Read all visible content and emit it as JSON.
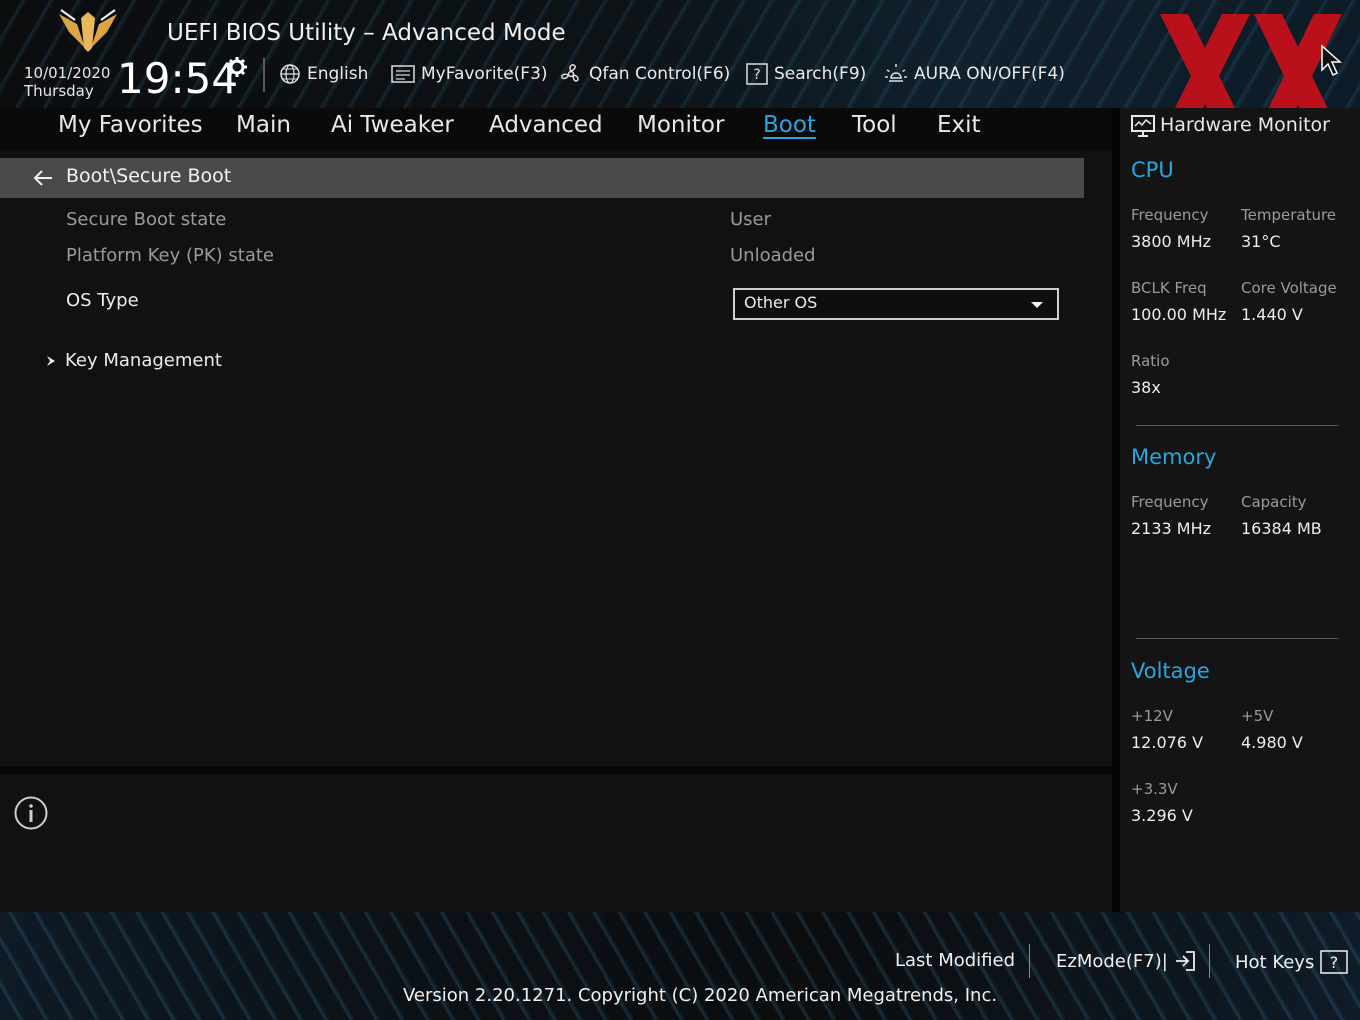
{
  "header": {
    "title": "UEFI BIOS Utility – Advanced Mode",
    "date": "10/01/2020",
    "day": "Thursday",
    "time": "19:54",
    "tools": [
      {
        "label": "English",
        "icon": "globe-icon"
      },
      {
        "label": "MyFavorite(F3)",
        "icon": "favorite-list-icon"
      },
      {
        "label": "Qfan Control(F6)",
        "icon": "fan-icon"
      },
      {
        "label": "Search(F9)",
        "icon": "search-question-icon"
      },
      {
        "label": "AURA ON/OFF(F4)",
        "icon": "aura-light-icon"
      }
    ]
  },
  "menu": {
    "items": [
      "My Favorites",
      "Main",
      "Ai Tweaker",
      "Advanced",
      "Monitor",
      "Boot",
      "Tool",
      "Exit"
    ],
    "active": "Boot"
  },
  "content": {
    "breadcrumb": "Boot\\Secure Boot",
    "rows": [
      {
        "label": "Secure Boot state",
        "value": "User"
      },
      {
        "label": "Platform Key (PK) state",
        "value": "Unloaded"
      }
    ],
    "os_type": {
      "label": "OS Type",
      "selected": "Other OS"
    },
    "submenu": "Key Management"
  },
  "hardware_monitor": {
    "title": "Hardware Monitor",
    "cpu": {
      "title": "CPU",
      "frequency_label": "Frequency",
      "frequency": "3800 MHz",
      "temperature_label": "Temperature",
      "temperature": "31°C",
      "bclk_label": "BCLK Freq",
      "bclk": "100.00 MHz",
      "core_voltage_label": "Core Voltage",
      "core_voltage": "1.440 V",
      "ratio_label": "Ratio",
      "ratio": "38x"
    },
    "memory": {
      "title": "Memory",
      "frequency_label": "Frequency",
      "frequency": "2133 MHz",
      "capacity_label": "Capacity",
      "capacity": "16384 MB"
    },
    "voltage": {
      "title": "Voltage",
      "v12_label": "+12V",
      "v12": "12.076 V",
      "v5_label": "+5V",
      "v5": "4.980 V",
      "v33_label": "+3.3V",
      "v33": "3.296 V"
    }
  },
  "footer": {
    "last_modified": "Last Modified",
    "ezmode": "EzMode(F7)|",
    "hotkeys": "Hot Keys",
    "version": "Version 2.20.1271. Copyright (C) 2020 American Megatrends, Inc."
  },
  "colors": {
    "accent": "#27a7e0",
    "watermark": "#c8101a",
    "breadcrumb_bg": "#4a4a4a"
  }
}
